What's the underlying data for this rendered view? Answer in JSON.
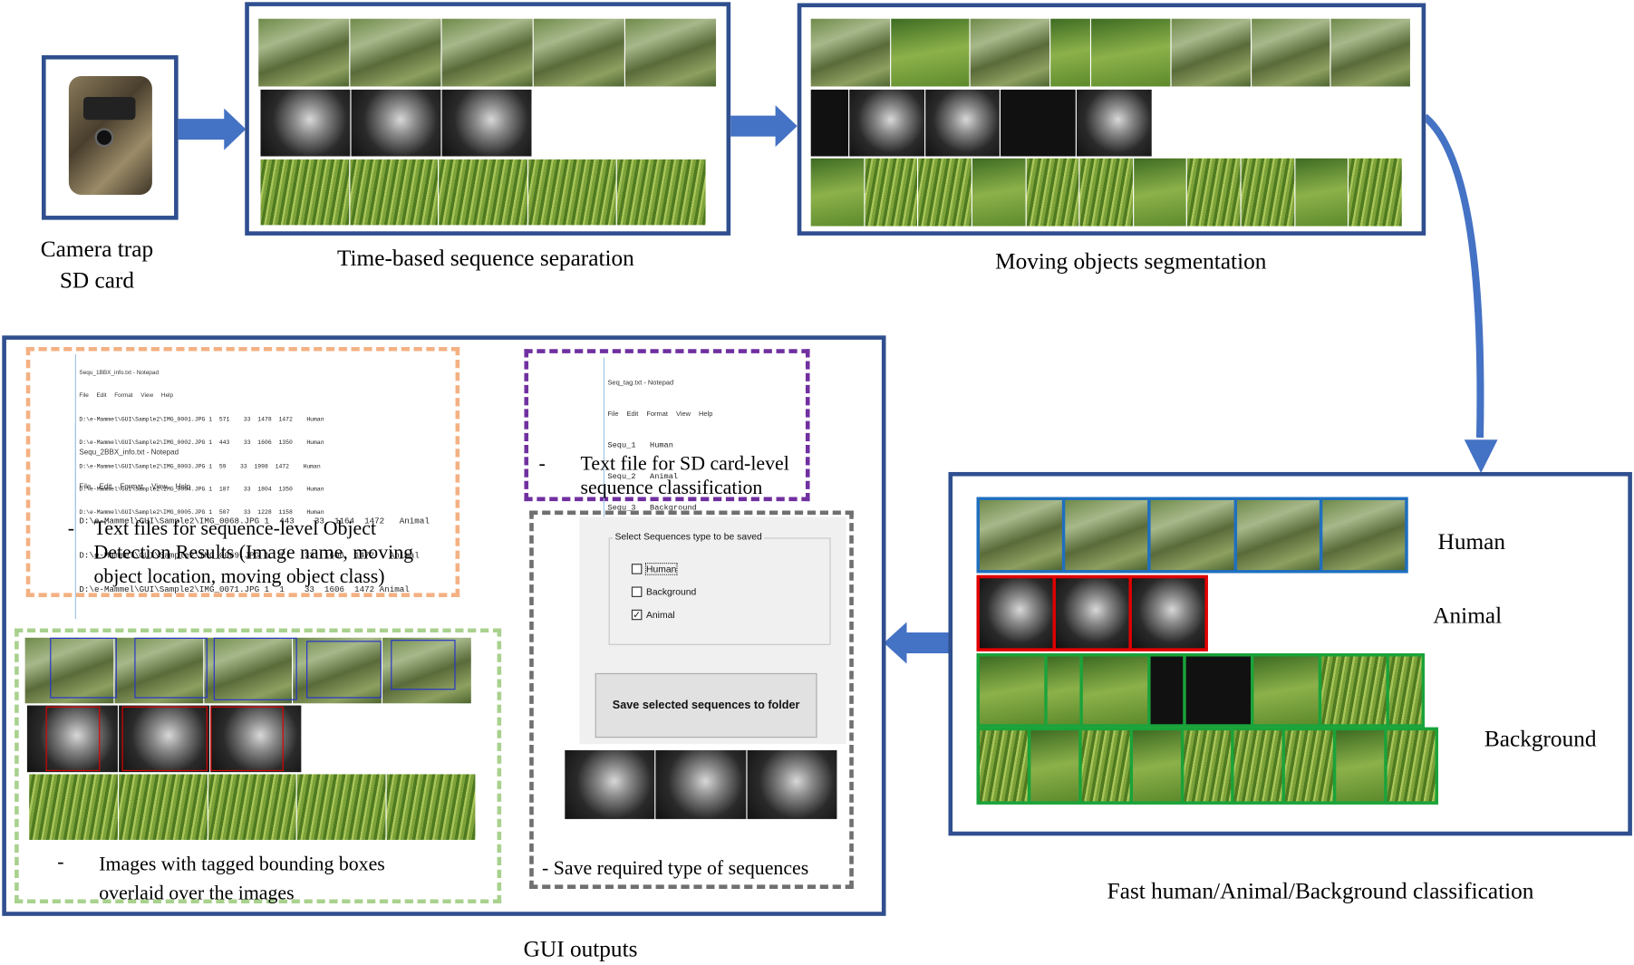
{
  "labels": {
    "camera": [
      "Camera trap",
      "SD card"
    ],
    "time_sep": "Time-based sequence separation",
    "moving": "Moving  objects segmentation",
    "classification": "Fast human/Animal/Background classification",
    "gui_outputs": "GUI outputs",
    "human": "Human",
    "animal": "Animal",
    "background": "Background"
  },
  "notepad1": {
    "title": "Sequ_1BBX_info.txt - Notepad",
    "menu": "File Edit Format View Help",
    "lines": [
      "D:\\e-Mammel\\GUI\\Sample2\\IMG_0001.JPG 1  571    33  1478  1472    Human",
      "D:\\e-Mammel\\GUI\\Sample2\\IMG_0002.JPG 1  443    33  1606  1350    Human",
      "D:\\e-Mammel\\GUI\\Sample2\\IMG_0003.JPG 1  59    33  1998  1472    Human",
      "D:\\e-Mammel\\GUI\\Sample2\\IMG_0004.JPG 1  187    33  1804  1350    Human",
      "D:\\e-Mammel\\GUI\\Sample2\\IMG_0005.JPG 1  507    33  1228  1158    Human"
    ]
  },
  "notepad2": {
    "title": "Sequ_2BBX_info.txt - Notepad",
    "menu": "File Edit Format View Help",
    "lines": [
      "D:\\e-Mammel\\GUI\\Sample2\\IMG_0068.JPG 1  443    33  1164  1472   Animal",
      "D:\\e-Mammel\\GUI\\Sample2\\IMG_0069.JPG 1  1    33  1606  1472   Animal",
      "D:\\e-Mammel\\GUI\\Sample2\\IMG_0071.JPG 1  1    33  1606  1472 Animal"
    ]
  },
  "notepad3": {
    "title": "Seq_tag.txt - Notepad",
    "menu": "File Edit Format View Help",
    "lines": [
      "Sequ_1   Human",
      "Sequ_2   Animal",
      "Sequ_3   Background"
    ]
  },
  "captions": {
    "text_files": [
      "-",
      "Text files for sequence-level Object",
      "Detection Results (Image name, moving",
      "object location, moving object class)"
    ],
    "sd_card": [
      "-",
      "Text file for SD card-level",
      "sequence classification"
    ],
    "images": [
      "-",
      "Images with tagged bounding boxes",
      "overlaid over the images"
    ],
    "save": "- Save required type of sequences"
  },
  "gui": {
    "group_title": "Select Sequences type to be saved",
    "options": [
      {
        "label": "Human",
        "checked": false
      },
      {
        "label": "Background",
        "checked": false
      },
      {
        "label": "Animal",
        "checked": true
      }
    ],
    "save_button": "Save selected sequences to folder"
  },
  "colors": {
    "frame_blue": "#2f4f8f",
    "arrow_blue": "#4472c4",
    "human_border": "#1f6fbf",
    "animal_border": "#e00000",
    "background_border": "#1aa33a",
    "orange_dash": "#f4b183",
    "purple_dash": "#7030a0",
    "gray_dash": "#707070",
    "green_dash": "#a9d18e"
  }
}
